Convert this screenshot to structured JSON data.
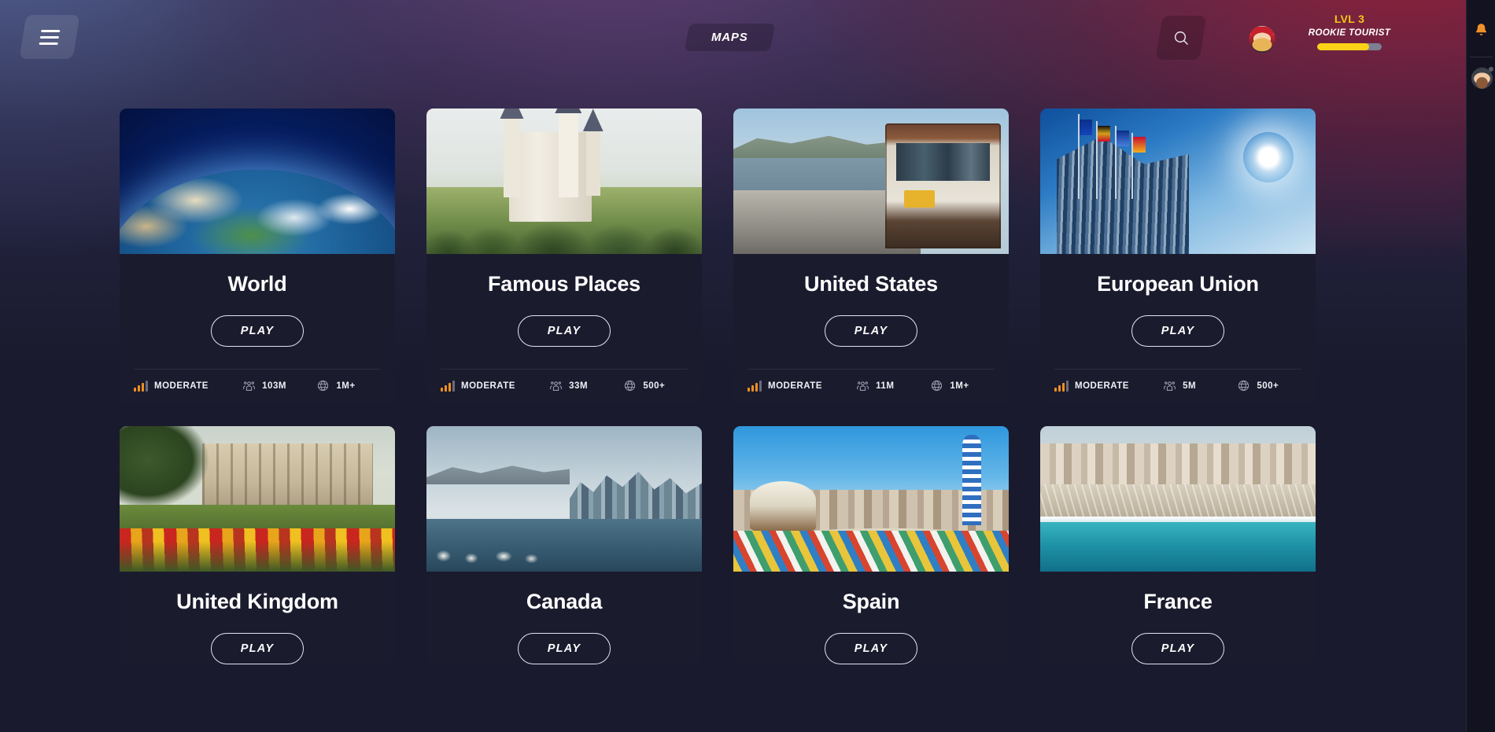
{
  "header": {
    "menu_icon": "hamburger-icon",
    "tab_label": "MAPS",
    "search_icon": "search-icon",
    "avatar_icon": "user-avatar",
    "level_label": "LVL 3",
    "rank_label": "ROOKIE TOURIST",
    "xp_percent": 80,
    "accent_color": "#fbd217",
    "level_text_color": "#f5c518"
  },
  "right_rail": {
    "bell_icon": "bell-icon",
    "bell_color": "#f0922a",
    "avatar_icon": "player-avatar",
    "status_dot": "offline-status-dot"
  },
  "stat_icons": {
    "difficulty": "signal-bars-icon",
    "population": "people-group-icon",
    "plays": "globe-clock-icon"
  },
  "card_defaults": {
    "play_label": "PLAY"
  },
  "cards": [
    {
      "title": "World",
      "art": "world",
      "play_label": "PLAY",
      "difficulty": "MODERATE",
      "difficulty_level": 3,
      "population": "103M",
      "plays": "1M+"
    },
    {
      "title": "Famous Places",
      "art": "famous",
      "play_label": "PLAY",
      "difficulty": "MODERATE",
      "difficulty_level": 3,
      "population": "33M",
      "plays": "500+"
    },
    {
      "title": "United States",
      "art": "usa",
      "play_label": "PLAY",
      "difficulty": "MODERATE",
      "difficulty_level": 3,
      "population": "11M",
      "plays": "1M+"
    },
    {
      "title": "European Union",
      "art": "eu",
      "play_label": "PLAY",
      "difficulty": "MODERATE",
      "difficulty_level": 3,
      "population": "5M",
      "plays": "500+"
    },
    {
      "title": "United Kingdom",
      "art": "uk",
      "play_label": "PLAY",
      "difficulty": "",
      "difficulty_level": 3,
      "population": "",
      "plays": ""
    },
    {
      "title": "Canada",
      "art": "canada",
      "play_label": "PLAY",
      "difficulty": "",
      "difficulty_level": 3,
      "population": "",
      "plays": ""
    },
    {
      "title": "Spain",
      "art": "spain",
      "play_label": "PLAY",
      "difficulty": "",
      "difficulty_level": 3,
      "population": "",
      "plays": ""
    },
    {
      "title": "France",
      "art": "france",
      "play_label": "PLAY",
      "difficulty": "",
      "difficulty_level": 3,
      "population": "",
      "plays": ""
    }
  ]
}
